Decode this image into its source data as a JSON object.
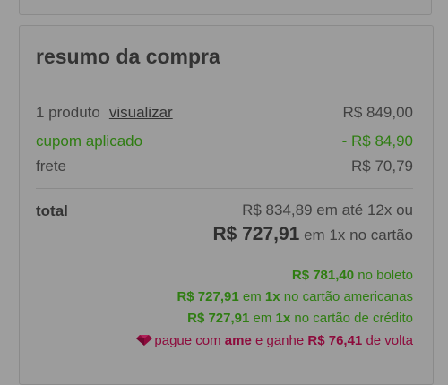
{
  "summary": {
    "title": "resumo da compra",
    "items": {
      "count_label": "1 produto",
      "view_link": "visualizar",
      "price": "R$ 849,00"
    },
    "coupon": {
      "label": "cupom aplicado",
      "value": "- R$ 84,90"
    },
    "shipping": {
      "label": "frete",
      "value": "R$ 70,79"
    },
    "total": {
      "label": "total",
      "installments": "R$ 834,89 em até 12x ou",
      "single_amount": "R$ 727,91",
      "single_suffix": "em 1x no cartão"
    },
    "offers": {
      "boleto_amount": "R$ 781,40",
      "boleto_text": "no boleto",
      "card_am_amount": "R$ 727,91",
      "card_am_mid": "em",
      "card_am_x": "1x",
      "card_am_text": "no cartão americanas",
      "credit_amount": "R$ 727,91",
      "credit_mid": "em",
      "credit_x": "1x",
      "credit_text": "no cartão de crédito",
      "ame_pre": "pague com",
      "ame_brand": "ame",
      "ame_mid": "e ganhe",
      "ame_amount": "R$ 76,41",
      "ame_post": "de volta"
    }
  },
  "colors": {
    "discount_green": "#2f7d12",
    "ame_magenta": "#8d0b3c",
    "overlay_gray": "#9e9e9e"
  },
  "icons": {
    "ame": "diamond-gem-icon"
  }
}
